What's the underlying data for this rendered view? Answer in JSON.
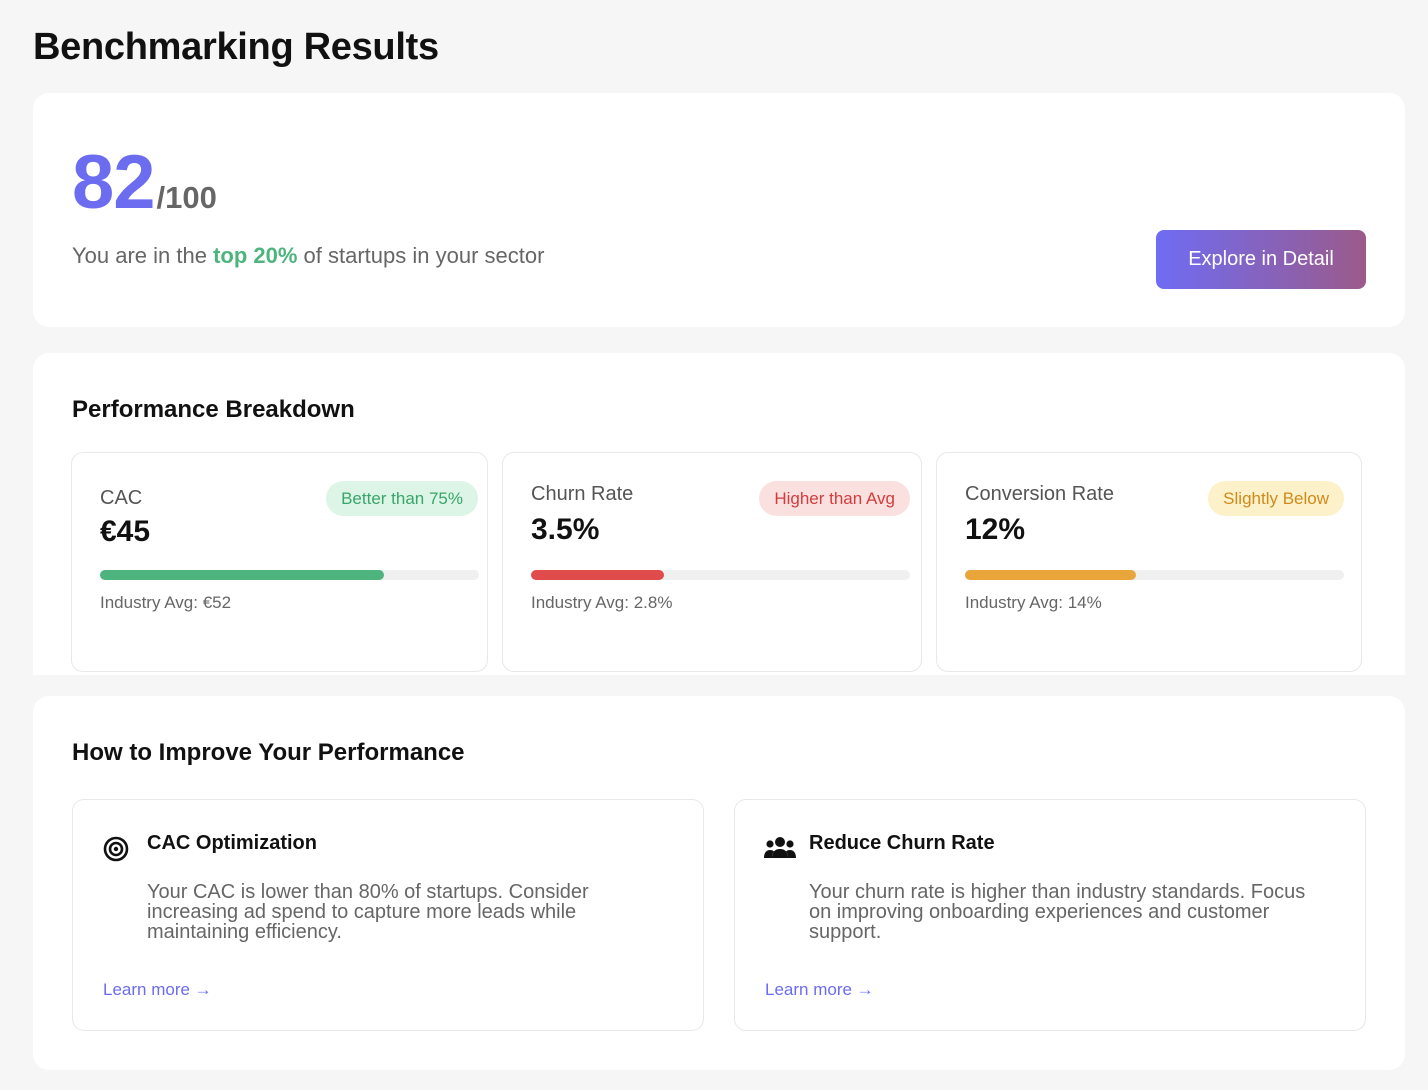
{
  "page": {
    "title": "Benchmarking Results"
  },
  "score": {
    "value": "82",
    "max": "/100",
    "caption_prefix": "You are in the ",
    "caption_highlight": "top 20%",
    "caption_suffix": " of startups in your sector",
    "explore_label": "Explore in Detail"
  },
  "breakdown": {
    "title": "Performance Breakdown",
    "metrics": [
      {
        "label": "CAC",
        "value": "€45",
        "badge": "Better than 75%",
        "badge_bg": "#dcf5e6",
        "badge_color": "#3aa56a",
        "bar_color": "#4cb47c",
        "progress": 0.75,
        "industry_avg": "Industry Avg: €52"
      },
      {
        "label": "Churn Rate",
        "value": "3.5%",
        "badge": "Higher than Avg",
        "badge_bg": "#fbe0e0",
        "badge_color": "#d23c3c",
        "bar_color": "#e04b4b",
        "progress": 0.35,
        "industry_avg": "Industry Avg: 2.8%"
      },
      {
        "label": "Conversion Rate",
        "value": "12%",
        "badge": "Slightly Below",
        "badge_bg": "#fdf1c9",
        "badge_color": "#cf8a1e",
        "bar_color": "#e9a43a",
        "progress": 0.45,
        "industry_avg": "Industry Avg: 14%"
      }
    ]
  },
  "improve": {
    "title": "How to Improve Your Performance",
    "tips": [
      {
        "icon": "target-icon",
        "title": "CAC Optimization",
        "body": "Your CAC is lower than 80% of startups. Consider increasing ad spend to capture more leads while maintaining efficiency.",
        "link": "Learn more →"
      },
      {
        "icon": "users-icon",
        "title": "Reduce Churn Rate",
        "body": "Your churn rate is higher than industry standards. Focus on improving onboarding experiences and customer support.",
        "link": "Learn more →"
      }
    ]
  }
}
